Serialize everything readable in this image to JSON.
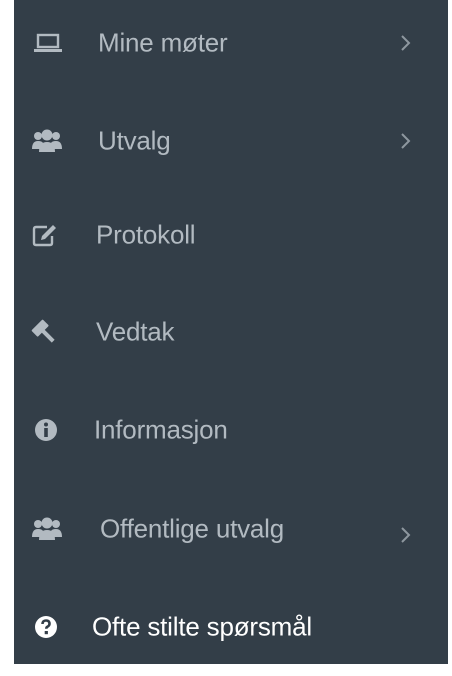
{
  "sidebar": {
    "items": [
      {
        "label": "Mine møter",
        "icon": "laptop-icon",
        "has_submenu": true
      },
      {
        "label": "Utvalg",
        "icon": "users-icon",
        "has_submenu": true
      },
      {
        "label": "Protokoll",
        "icon": "edit-icon",
        "has_submenu": false
      },
      {
        "label": "Vedtak",
        "icon": "gavel-icon",
        "has_submenu": false
      },
      {
        "label": "Informasjon",
        "icon": "info-circle-icon",
        "has_submenu": false
      },
      {
        "label": "Offentlige utvalg",
        "icon": "users-icon",
        "has_submenu": true
      },
      {
        "label": "Ofte stilte spørsmål",
        "icon": "question-circle-icon",
        "has_submenu": false,
        "active": true
      }
    ]
  },
  "colors": {
    "background": "#333e48",
    "text": "#b2bac1",
    "active_text": "#ffffff"
  }
}
